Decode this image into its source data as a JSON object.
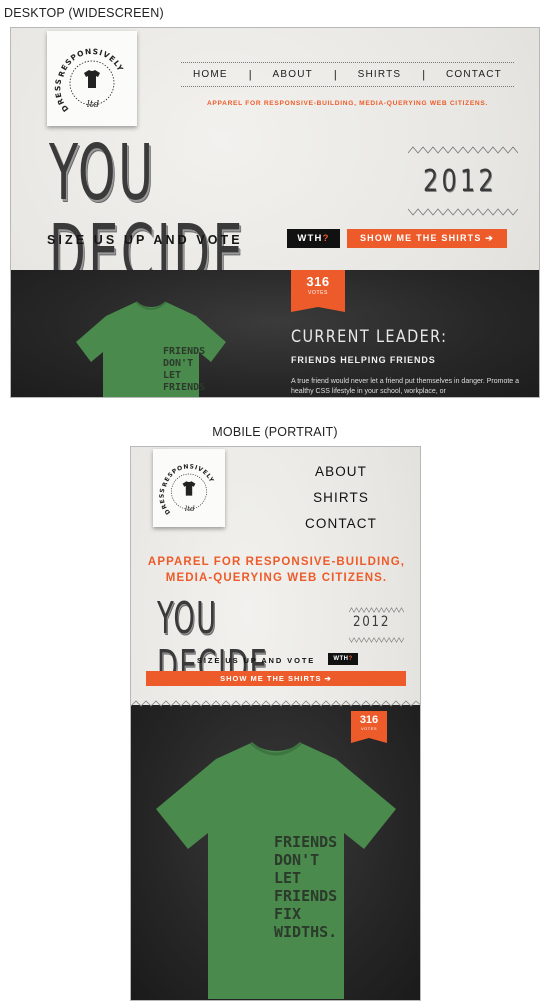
{
  "captions": {
    "desktop": "DESKTOP (WIDESCREEN)",
    "mobile": "MOBILE (PORTRAIT)"
  },
  "logo": {
    "top_text": "RESPONSIVELY",
    "side_text": "DRESS",
    "sub_text": "ltd",
    "icon": "tshirt-icon"
  },
  "nav": {
    "items": [
      "HOME",
      "ABOUT",
      "SHIRTS",
      "CONTACT"
    ],
    "separator": "|"
  },
  "mobile_nav": {
    "items": [
      "ABOUT",
      "SHIRTS",
      "CONTACT"
    ]
  },
  "tagline": {
    "desktop": "APPAREL FOR RESPONSIVE-BUILDING, MEDIA-QUERYING WEB CITIZENS.",
    "mobile_line1": "APPAREL FOR RESPONSIVE-BUILDING,",
    "mobile_line2": "MEDIA-QUERYING WEB CITIZENS."
  },
  "hero": {
    "title": "YOU DECIDE",
    "year": "2012",
    "size_us_up": "SIZE US UP AND VOTE",
    "wth_prefix": "WTH",
    "wth_q": "?",
    "show_shirts": "SHOW ME THE SHIRTS ➔"
  },
  "votes": {
    "count": "316",
    "label": "VOTES"
  },
  "leader": {
    "heading": "CURRENT LEADER:",
    "shirt_name": "FRIENDS HELPING FRIENDS",
    "description": "A true friend would never let a friend put themselves in danger. Promote a healthy CSS lifestyle in your school, workplace, or"
  },
  "shirt_print": {
    "desktop_lines": [
      "FRIENDS",
      "DON'T",
      "LET",
      "FRIENDS"
    ],
    "mobile_lines": [
      "FRIENDS",
      "DON'T",
      "LET",
      "FRIENDS",
      "FIX",
      "WIDTHS."
    ]
  },
  "colors": {
    "accent": "#ee5b2a",
    "paper": "#ebeae6",
    "dark": "#262626",
    "shirt_green": "#4a8a4c",
    "ink": "#3a3a3a"
  }
}
